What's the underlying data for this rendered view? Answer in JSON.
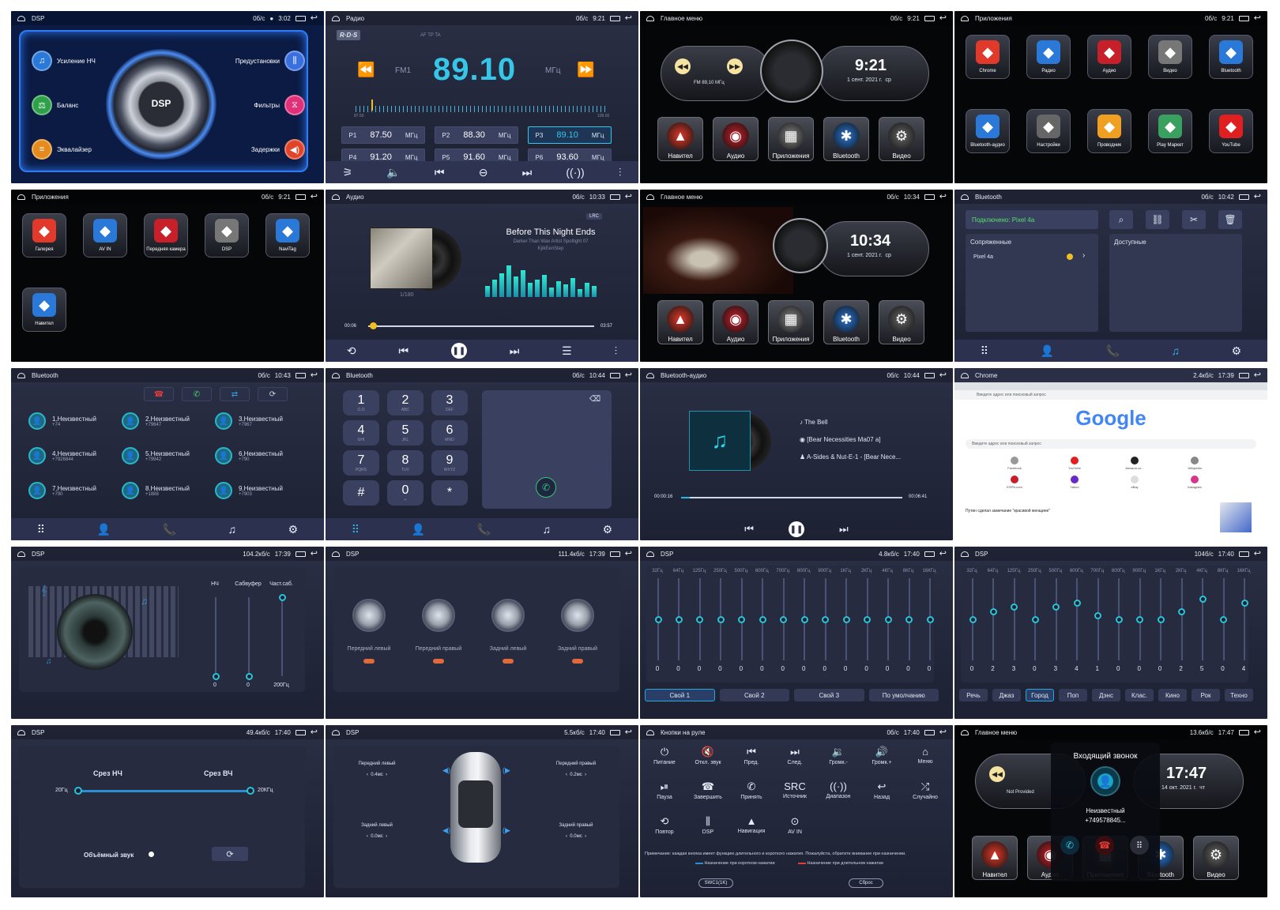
{
  "p1": {
    "status": {
      "title": "DSP",
      "right": "0б/с",
      "time": "3:02"
    },
    "center": "DSP",
    "items": [
      {
        "label": "Усиление НЧ",
        "icon": "bass-icon"
      },
      {
        "label": "Баланс",
        "icon": "balance-icon"
      },
      {
        "label": "Эквалайзер",
        "icon": "equalizer-icon"
      },
      {
        "label": "Предустановки",
        "icon": "presets-icon"
      },
      {
        "label": "Фильтры",
        "icon": "filters-icon"
      },
      {
        "label": "Задержки",
        "icon": "delay-icon"
      }
    ]
  },
  "p2": {
    "status": {
      "title": "Радио",
      "right": "0б/с",
      "time": "9:21"
    },
    "rds": "R·D·S",
    "flags": "AF  TP  TA",
    "band": "FM1",
    "freq": "89.10",
    "unit": "МГц",
    "scale_min": "87.50",
    "scale_max": "108.00",
    "presets": [
      {
        "p": "P1",
        "f": "87.50",
        "u": "МГц"
      },
      {
        "p": "P2",
        "f": "88.30",
        "u": "МГц"
      },
      {
        "p": "P3",
        "f": "89.10",
        "u": "МГц"
      },
      {
        "p": "P4",
        "f": "91.20",
        "u": "МГц"
      },
      {
        "p": "P5",
        "f": "91.60",
        "u": "МГц"
      },
      {
        "p": "P6",
        "f": "93.60",
        "u": "МГц"
      }
    ],
    "active_preset": 2
  },
  "p3": {
    "status": {
      "title": "Главное меню",
      "right": "0б/с",
      "time": "9:21"
    },
    "fm": "FM 89,10 МГц",
    "clock": "9:21",
    "date": "1 сент. 2021 г.",
    "day": "ср",
    "apps": [
      "Навител",
      "Аудио",
      "Приложения",
      "Bluetooth",
      "Видео"
    ]
  },
  "p4": {
    "status": {
      "title": "Приложения",
      "right": "0б/с",
      "time": "9:21"
    },
    "apps": [
      "Chrome",
      "Радио",
      "Аудио",
      "Видео",
      "Bluetooth",
      "Bluetooth-аудио",
      "Настройки",
      "Проводник",
      "Play Маркет",
      "YouTube"
    ]
  },
  "p5": {
    "status": {
      "title": "Приложения",
      "right": "0б/с",
      "time": "9:21"
    },
    "apps": [
      "Галерея",
      "AV IN",
      "Передняя камера",
      "DSP",
      "NaviTag",
      "Навител"
    ]
  },
  "p6": {
    "status": {
      "title": "Аудио",
      "right": "0б/с",
      "time": "10:33"
    },
    "badge": "LRC",
    "track": "Before This Night Ends",
    "artist": "Darker Than Wax Artist Spotlight 07",
    "album": "KjikEenStep",
    "counter": "1/180",
    "t_start": "00:06",
    "t_end": "03:57",
    "progress": 0.02
  },
  "p7": {
    "status": {
      "title": "Главное меню",
      "right": "0б/с",
      "time": "10:34"
    },
    "clock": "10:34",
    "date": "1 сент. 2021 г.",
    "day": "ср",
    "apps": [
      "Навител",
      "Аудио",
      "Приложения",
      "Bluetooth",
      "Видео"
    ]
  },
  "p8": {
    "status": {
      "title": "Bluetooth",
      "right": "0б/с",
      "time": "10:42"
    },
    "connected": "Подключено:  Pixel 4a",
    "paired": "Сопряженные",
    "available": "Доступные",
    "device": "Pixel 4a"
  },
  "p9": {
    "status": {
      "title": "Bluetooth",
      "right": "0б/с",
      "time": "10:43"
    },
    "contacts": [
      {
        "n": "1.Неизвестный",
        "t": "+74"
      },
      {
        "n": "2.Неизвестный",
        "t": "+79647"
      },
      {
        "n": "3.Неизвестный",
        "t": "+7967"
      },
      {
        "n": "4.Неизвестный",
        "t": "+7926844"
      },
      {
        "n": "5.Неизвестный",
        "t": "+79942"
      },
      {
        "n": "6.Неизвестный",
        "t": "+790"
      },
      {
        "n": "7.Неизвестный",
        "t": "+790"
      },
      {
        "n": "8.Неизвестный",
        "t": "+1888"
      },
      {
        "n": "9.Неизвестный",
        "t": "+7903"
      }
    ]
  },
  "p10": {
    "status": {
      "title": "Bluetooth",
      "right": "0б/с",
      "time": "10:44"
    },
    "keys": [
      {
        "d": "1",
        "s": "O.O"
      },
      {
        "d": "2",
        "s": "ABC"
      },
      {
        "d": "3",
        "s": "DEF"
      },
      {
        "d": "4",
        "s": "GHI"
      },
      {
        "d": "5",
        "s": "JKL"
      },
      {
        "d": "6",
        "s": "MNO"
      },
      {
        "d": "7",
        "s": "PQRS"
      },
      {
        "d": "8",
        "s": "TUV"
      },
      {
        "d": "9",
        "s": "WXYZ"
      },
      {
        "d": "#",
        "s": ""
      },
      {
        "d": "0",
        "s": "+"
      },
      {
        "d": "*",
        "s": ""
      }
    ]
  },
  "p11": {
    "status": {
      "title": "Bluetooth-аудио",
      "right": "0б/с",
      "time": "10:44"
    },
    "title": "The Bell",
    "album": "[Bear Necessities Ma07 a]",
    "artist": "A-Sides & Nut-E-1 - [Bear Nece...",
    "t_start": "00:00:16",
    "t_end": "00:06:41",
    "progress": 0.04
  },
  "p12": {
    "status": {
      "title": "Chrome",
      "right": "2.4кб/с",
      "time": "17:39"
    },
    "url": "Введите адрес или поисковый запрос",
    "logo": "Google",
    "search": "Введите адрес или поисковый запрос",
    "shortcuts": [
      "Facebook",
      "YouTube",
      "Amazon.co...",
      "Wikipedia",
      "ESPN.com",
      "Yahoo",
      "eBay",
      "Instagram"
    ],
    "article": "Путин сделал замечание \"красивой женщине\""
  },
  "p13": {
    "status": {
      "title": "DSP",
      "right": "104.2кб/с",
      "time": "17:39"
    },
    "sliders": [
      {
        "label": "НЧ",
        "value": "0",
        "level": 0
      },
      {
        "label": "Сабвуфер",
        "value": "0",
        "level": 0
      },
      {
        "label": "Част.саб.",
        "value": "200Гц",
        "level": 1
      }
    ]
  },
  "p14": {
    "status": {
      "title": "DSP",
      "right": "111.4кб/с",
      "time": "17:39"
    },
    "knobs": [
      "Передний левый",
      "Передний правый",
      "Задний левый",
      "Задний правый"
    ]
  },
  "p15": {
    "status": {
      "title": "DSP",
      "right": "4.8кб/с",
      "time": "17:40"
    },
    "bands": [
      "32Гц",
      "64Гц",
      "125Гц",
      "250Гц",
      "500Гц",
      "600Гц",
      "700Гц",
      "800Гц",
      "900Гц",
      "1КГц",
      "2КГц",
      "4КГц",
      "8КГц",
      "16КГц"
    ],
    "values": [
      0,
      0,
      0,
      0,
      0,
      0,
      0,
      0,
      0,
      0,
      0,
      0,
      0,
      0
    ],
    "presets": [
      "Свой 1",
      "Свой 2",
      "Свой 3",
      "По умолчанию"
    ],
    "active": 0
  },
  "p16": {
    "status": {
      "title": "DSP",
      "right": "104б/с",
      "time": "17:40"
    },
    "bands": [
      "32Гц",
      "64Гц",
      "125Гц",
      "250Гц",
      "500Гц",
      "600Гц",
      "700Гц",
      "800Гц",
      "900Гц",
      "1КГц",
      "2КГц",
      "4КГц",
      "8КГц",
      "16КГц"
    ],
    "values": [
      0,
      2,
      3,
      0,
      3,
      4,
      1,
      0,
      0,
      0,
      2,
      5,
      0,
      4
    ],
    "presets": [
      "Речь",
      "Джаз",
      "Город",
      "Поп",
      "Дэнс",
      "Клас.",
      "Кино",
      "Рок",
      "Техно"
    ],
    "active": 2
  },
  "p17": {
    "status": {
      "title": "DSP",
      "right": "49.4кб/с",
      "time": "17:40"
    },
    "low": "Срез НЧ",
    "high": "Срез ВЧ",
    "low_v": "20Гц",
    "high_v": "20КГц",
    "surround": "Объёмный звук"
  },
  "p18": {
    "status": {
      "title": "DSP",
      "right": "5.5кб/с",
      "time": "17:40"
    },
    "fl": "Передний левый",
    "fl_v": "0.4мс",
    "fr": "Передний правый",
    "fr_v": "0.2мс",
    "rl": "Задний левый",
    "rl_v": "0.0мс",
    "rr": "Задний правый",
    "rr_v": "0.0мс"
  },
  "p19": {
    "status": {
      "title": "Кнопки на руле",
      "right": "0б/с",
      "time": "17:40"
    },
    "buttons": [
      {
        "l": "Питание",
        "i": "⏻"
      },
      {
        "l": "Откл. звук",
        "i": "🔇"
      },
      {
        "l": "Пред.",
        "i": "⏮"
      },
      {
        "l": "След.",
        "i": "⏭"
      },
      {
        "l": "Громк.-",
        "i": "🔉"
      },
      {
        "l": "Громк.+",
        "i": "🔊"
      },
      {
        "l": "Меню",
        "i": "⌂"
      },
      {
        "l": "Пауза",
        "i": "⏯"
      },
      {
        "l": "Завершить",
        "i": "☎"
      },
      {
        "l": "Принять",
        "i": "✆"
      },
      {
        "l": "Источник",
        "i": "SRC"
      },
      {
        "l": "Диапазон",
        "i": "((·))"
      },
      {
        "l": "Назад",
        "i": "↩"
      },
      {
        "l": "Случайно",
        "i": "⤮"
      },
      {
        "l": "Повтор",
        "i": "⟲"
      },
      {
        "l": "DSP",
        "i": "⫼"
      },
      {
        "l": "Навигация",
        "i": "▲"
      },
      {
        "l": "AV IN",
        "i": "⊙"
      }
    ],
    "note": "Примечание: каждая кнопка имеет функцию длительного и короткого нажатия. Пожалуйста, обратите внимание при назначении.",
    "short": "Назначение при коротком нажатии",
    "long": "Назначение при длительном нажатии",
    "swc": "SWC1(1K)",
    "reset": "Сброс"
  },
  "p20": {
    "status": {
      "title": "Главное меню",
      "right": "13.6кб/с",
      "time": "17:47"
    },
    "np": "Not Provided",
    "clock": "17:47",
    "date": "14 окт. 2021 г.",
    "day": "чт",
    "incoming": "Входящий звонок",
    "caller": "Неизвестный",
    "number": "+749578845...",
    "apps": [
      "Навител",
      "Аудио",
      "Приложения",
      "Bluetooth",
      "Видео"
    ]
  }
}
